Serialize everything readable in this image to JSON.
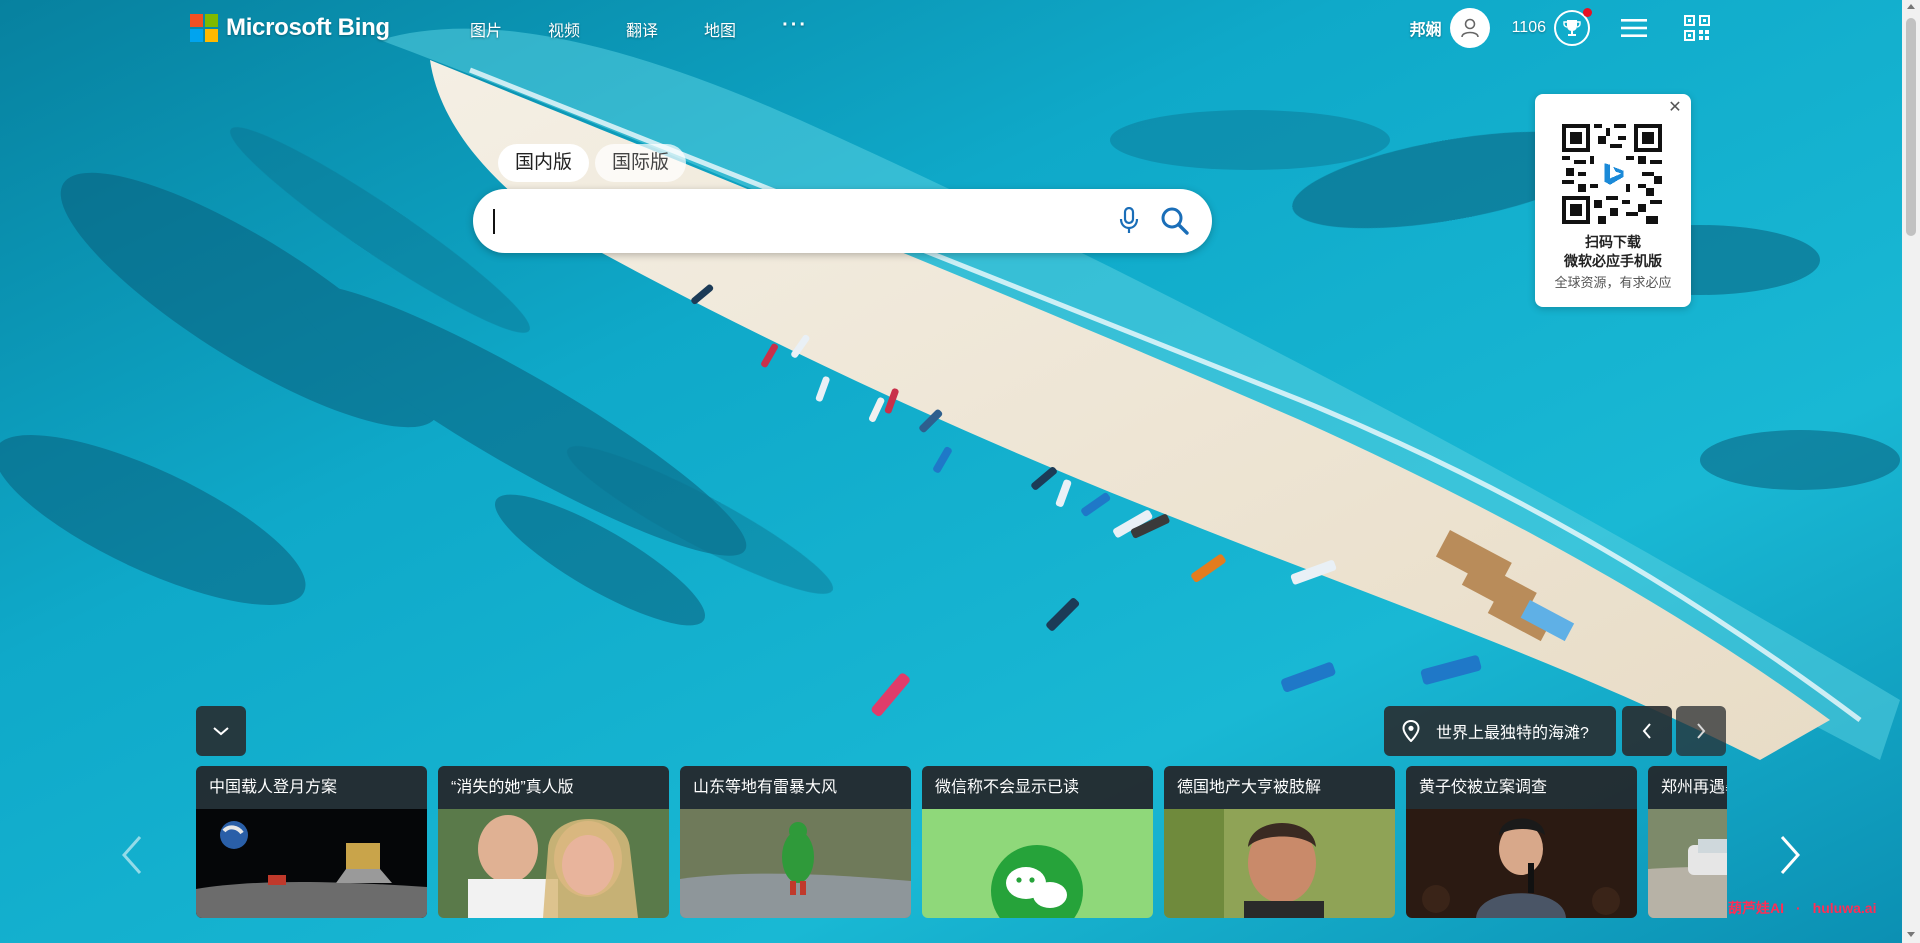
{
  "brand": {
    "name": "Microsoft Bing"
  },
  "nav": {
    "items": [
      "图片",
      "视频",
      "翻译",
      "地图"
    ],
    "more": "···"
  },
  "user": {
    "name": "邦娴",
    "points": "1106"
  },
  "search": {
    "tabs": [
      {
        "label": "国内版",
        "active": true
      },
      {
        "label": "国际版",
        "active": false
      }
    ],
    "value": "",
    "placeholder": ""
  },
  "qr_card": {
    "line1": "扫码下载",
    "line2": "微软必应手机版",
    "line3": "全球资源，有求必应"
  },
  "image_info": {
    "title": "世界上最独特的海滩?"
  },
  "news": [
    {
      "headline": "中国载人登月方案",
      "thumb": "moon-lander-image"
    },
    {
      "headline": "“消失的她”真人版",
      "thumb": "couple-portrait-image"
    },
    {
      "headline": "山东等地有雷暴大风",
      "thumb": "child-in-rain-image"
    },
    {
      "headline": "微信称不会显示已读",
      "thumb": "wechat-logo-image"
    },
    {
      "headline": "德国地产大亨被肢解",
      "thumb": "smiling-man-image"
    },
    {
      "headline": "黄子佼被立案调查",
      "thumb": "speaker-on-stage-image"
    },
    {
      "headline": "郑州再遇暴雨",
      "thumb": "flooded-car-image"
    }
  ],
  "watermark": {
    "brand": "葫芦娃AI",
    "separator": "·",
    "domain": "huluwa.ai"
  },
  "colors": {
    "accent": "#0078d4",
    "notify": "#e81123",
    "watermark": "#ff2d55"
  }
}
